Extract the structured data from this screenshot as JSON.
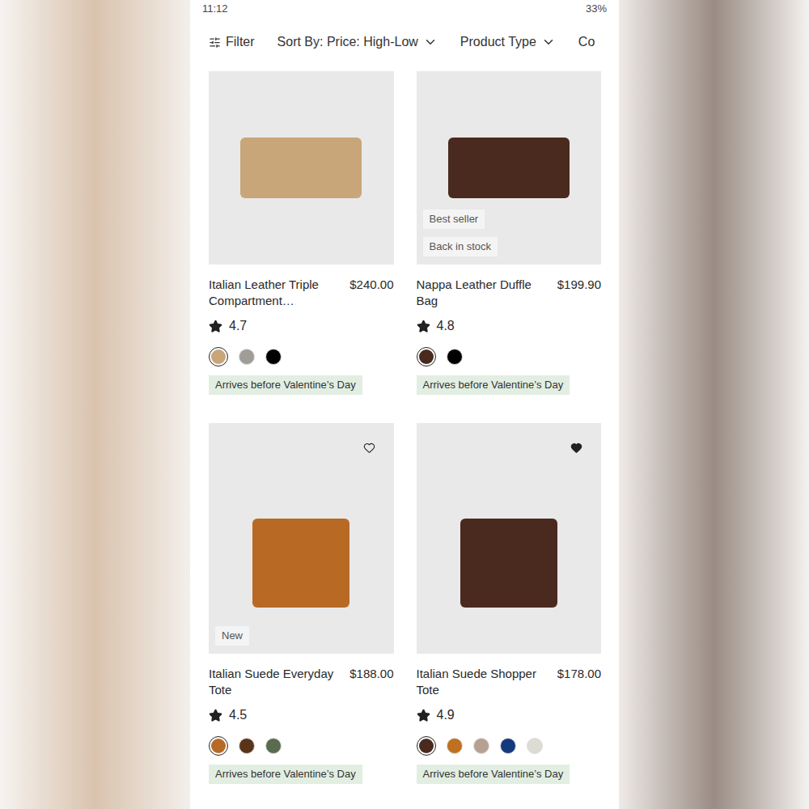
{
  "status_bar": {
    "time": "11:12",
    "battery": "33%"
  },
  "toolbar": {
    "filter": "Filter",
    "sort": "Sort By: Price: High-Low",
    "product_type": "Product Type",
    "more": "Co"
  },
  "products": [
    {
      "name": "Italian Leather Triple Compartment…",
      "price": "$240.00",
      "rating": "4.7",
      "badges": [],
      "heart_shown": false,
      "favorited": false,
      "swatches": [
        {
          "color": "#c9a57a",
          "selected": true
        },
        {
          "color": "#a09c98",
          "selected": false
        },
        {
          "color": "#000000",
          "selected": false
        }
      ],
      "delivery": "Arrives before Valentine’s Day"
    },
    {
      "name": "Nappa Leather Duffle Bag",
      "price": "$199.90",
      "rating": "4.8",
      "badges": [
        "Best seller",
        "Back in stock"
      ],
      "heart_shown": false,
      "favorited": false,
      "swatches": [
        {
          "color": "#4a2a1e",
          "selected": true
        },
        {
          "color": "#000000",
          "selected": false
        }
      ],
      "delivery": "Arrives before Valentine’s Day"
    },
    {
      "name": "Italian Suede Everyday Tote",
      "price": "$188.00",
      "rating": "4.5",
      "badges": [
        "New"
      ],
      "heart_shown": true,
      "favorited": false,
      "swatches": [
        {
          "color": "#b86a25",
          "selected": true
        },
        {
          "color": "#5a3418",
          "selected": false
        },
        {
          "color": "#5a6b4e",
          "selected": false
        }
      ],
      "delivery": "Arrives before Valentine’s Day"
    },
    {
      "name": "Italian Suede Shopper Tote",
      "price": "$178.00",
      "rating": "4.9",
      "badges": [],
      "heart_shown": true,
      "favorited": true,
      "swatches": [
        {
          "color": "#4a2a1e",
          "selected": true
        },
        {
          "color": "#c0701f",
          "selected": false
        },
        {
          "color": "#b8a090",
          "selected": false
        },
        {
          "color": "#133a7d",
          "selected": false
        },
        {
          "color": "#dcdcd4",
          "selected": false
        }
      ],
      "delivery": "Arrives before Valentine’s Day"
    }
  ]
}
